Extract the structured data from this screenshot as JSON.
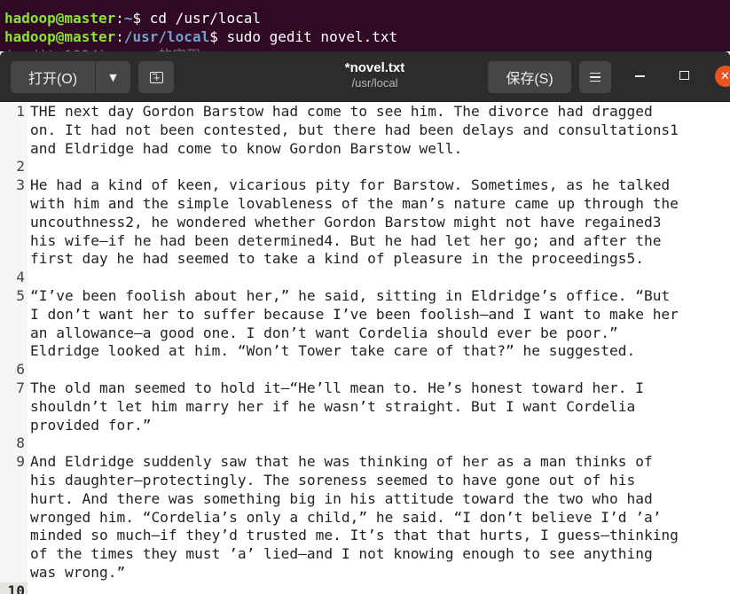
{
  "terminal": {
    "lines": [
      {
        "user": "hadoop@master",
        "sep": ":",
        "path": "~",
        "cmd": "$ cd /usr/local"
      },
      {
        "user": "hadoop@master",
        "sep": ":",
        "path": "/usr/local",
        "cmd": "$ sudo gedit novel.txt"
      }
    ],
    "partial_line": "(gedit:1234): ... 的实现"
  },
  "headerbar": {
    "open_label": "打开(O)",
    "open_arrow": "▼",
    "new_tab_icon": "new-tab-icon",
    "title": "*novel.txt",
    "subtitle": "/usr/local",
    "save_label": "保存(S)",
    "menu_icon": "hamburger-menu-icon",
    "minimize_icon": "minimize-icon",
    "maximize_icon": "maximize-icon",
    "close_icon": "close-icon",
    "close_glyph": "✕",
    "close_color": "#e95420"
  },
  "editor": {
    "lines": [
      {
        "n": "1",
        "visual": [
          "THE next day Gordon Barstow had come to see him. The divorce had dragged",
          "on. It had not been contested, but there had been delays and consultations1",
          "and Eldridge had come to know Gordon Barstow well."
        ]
      },
      {
        "n": "2",
        "visual": [
          ""
        ]
      },
      {
        "n": "3",
        "visual": [
          "He had a kind of keen, vicarious pity for Barstow. Sometimes, as he talked",
          "with him and the simple lovableness of the man’s nature came up through the",
          "uncouthness2, he wondered whether Gordon Barstow might not have regained3",
          "his wife—if he had been determined4. But he had let her go; and after the",
          "first day he had seemed to take a kind of pleasure in the proceedings5."
        ]
      },
      {
        "n": "4",
        "visual": [
          ""
        ]
      },
      {
        "n": "5",
        "visual": [
          "“I’ve been foolish about her,” he said, sitting in Eldridge’s office. “But",
          "I don’t want her to suffer because I’ve been foolish—and I want to make her",
          "an allowance—a good one. I don’t want Cordelia should ever be poor.”",
          "Eldridge looked at him. “Won’t Tower take care of that?” he suggested."
        ]
      },
      {
        "n": "6",
        "visual": [
          ""
        ]
      },
      {
        "n": "7",
        "visual": [
          "The old man seemed to hold it—“He’ll mean to. He’s honest toward her. I",
          "shouldn’t let him marry her if he wasn’t straight. But I want Cordelia",
          "provided for.”"
        ]
      },
      {
        "n": "8",
        "visual": [
          ""
        ]
      },
      {
        "n": "9",
        "visual": [
          "And Eldridge suddenly saw that he was thinking of her as a man thinks of",
          "his daughter—protectingly. The soreness seemed to have gone out of his",
          "hurt. And there was something big in his attitude toward the two who had",
          "wronged him. “Cordelia’s only a child,” he said. “I don’t believe I’d ’a’",
          "minded so much—if they’d trusted me. It’s that that hurts, I guess—thinking",
          "of the times they must ’a’ lied—and I not knowing enough to see anything",
          "was wrong.”"
        ]
      },
      {
        "n": "10",
        "visual": [
          ""
        ],
        "current": true
      }
    ]
  }
}
